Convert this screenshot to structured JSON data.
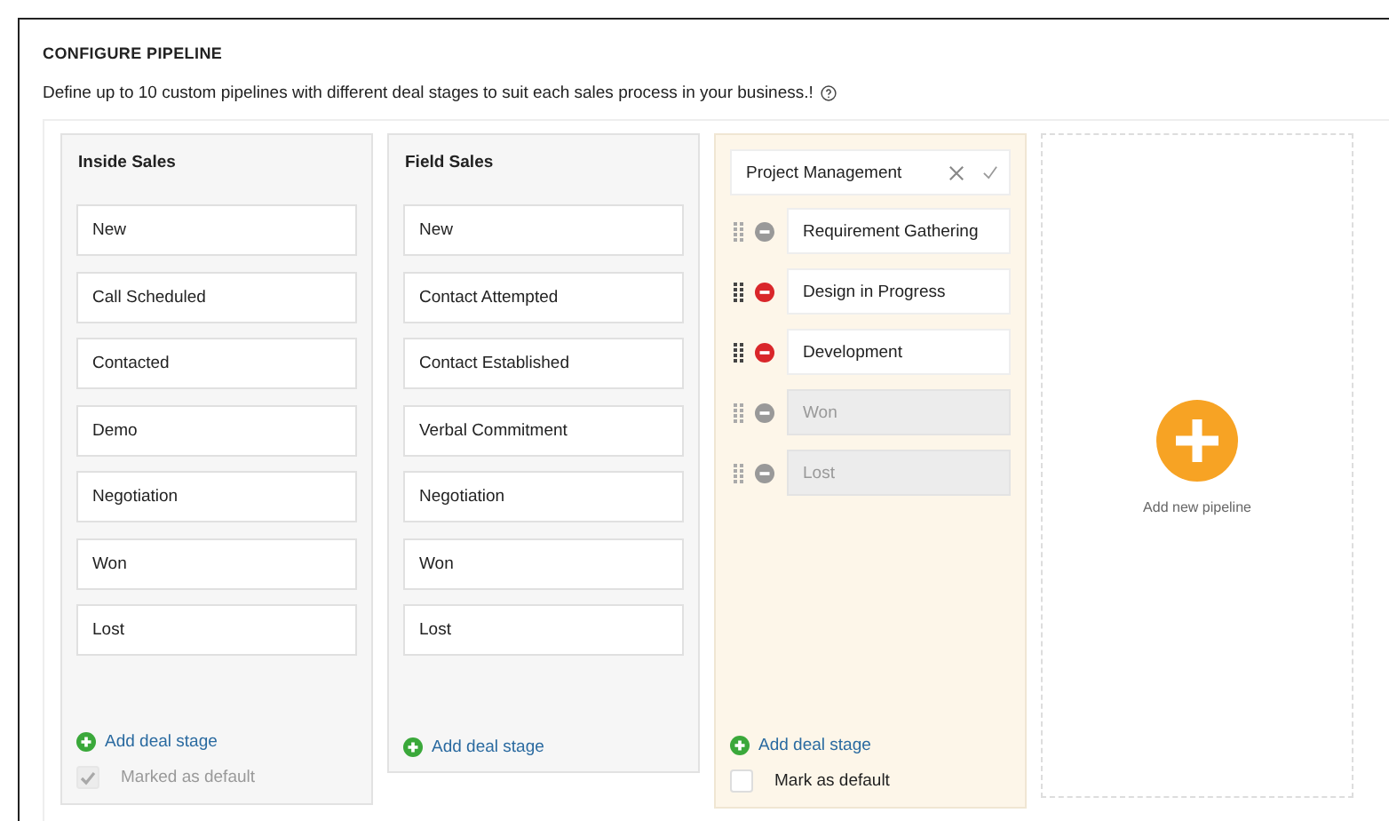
{
  "title": "CONFIGURE PIPELINE",
  "description": "Define up to 10 custom pipelines with different deal stages to suit each sales process in your business.!",
  "pipelines": [
    {
      "kind": "view",
      "name": "Inside Sales",
      "stages": [
        {
          "label": "New"
        },
        {
          "label": "Call Scheduled"
        },
        {
          "label": "Contacted"
        },
        {
          "label": "Demo"
        },
        {
          "label": "Negotiation"
        },
        {
          "label": "Won"
        },
        {
          "label": "Lost"
        }
      ],
      "add_stage": "Add deal stage",
      "default": {
        "label": "Marked as default",
        "checked": true,
        "disabled": true
      }
    },
    {
      "kind": "view",
      "name": "Field Sales",
      "stages": [
        {
          "label": "New"
        },
        {
          "label": "Contact Attempted"
        },
        {
          "label": "Contact Established"
        },
        {
          "label": "Verbal Commitment"
        },
        {
          "label": "Negotiation"
        },
        {
          "label": "Won"
        },
        {
          "label": "Lost"
        }
      ],
      "add_stage": "Add deal stage"
    },
    {
      "kind": "editing",
      "name": "Project Management",
      "stages": [
        {
          "label": "Requirement Gathering",
          "removable": false,
          "disabled": false
        },
        {
          "label": "Design in Progress",
          "removable": true,
          "disabled": false
        },
        {
          "label": "Development",
          "removable": true,
          "disabled": false
        },
        {
          "label": "Won",
          "removable": false,
          "disabled": true
        },
        {
          "label": "Lost",
          "removable": false,
          "disabled": true
        }
      ],
      "add_stage": "Add deal stage",
      "default": {
        "label": "Mark as default",
        "checked": false,
        "disabled": false
      }
    }
  ],
  "add_pipeline": "Add new pipeline"
}
